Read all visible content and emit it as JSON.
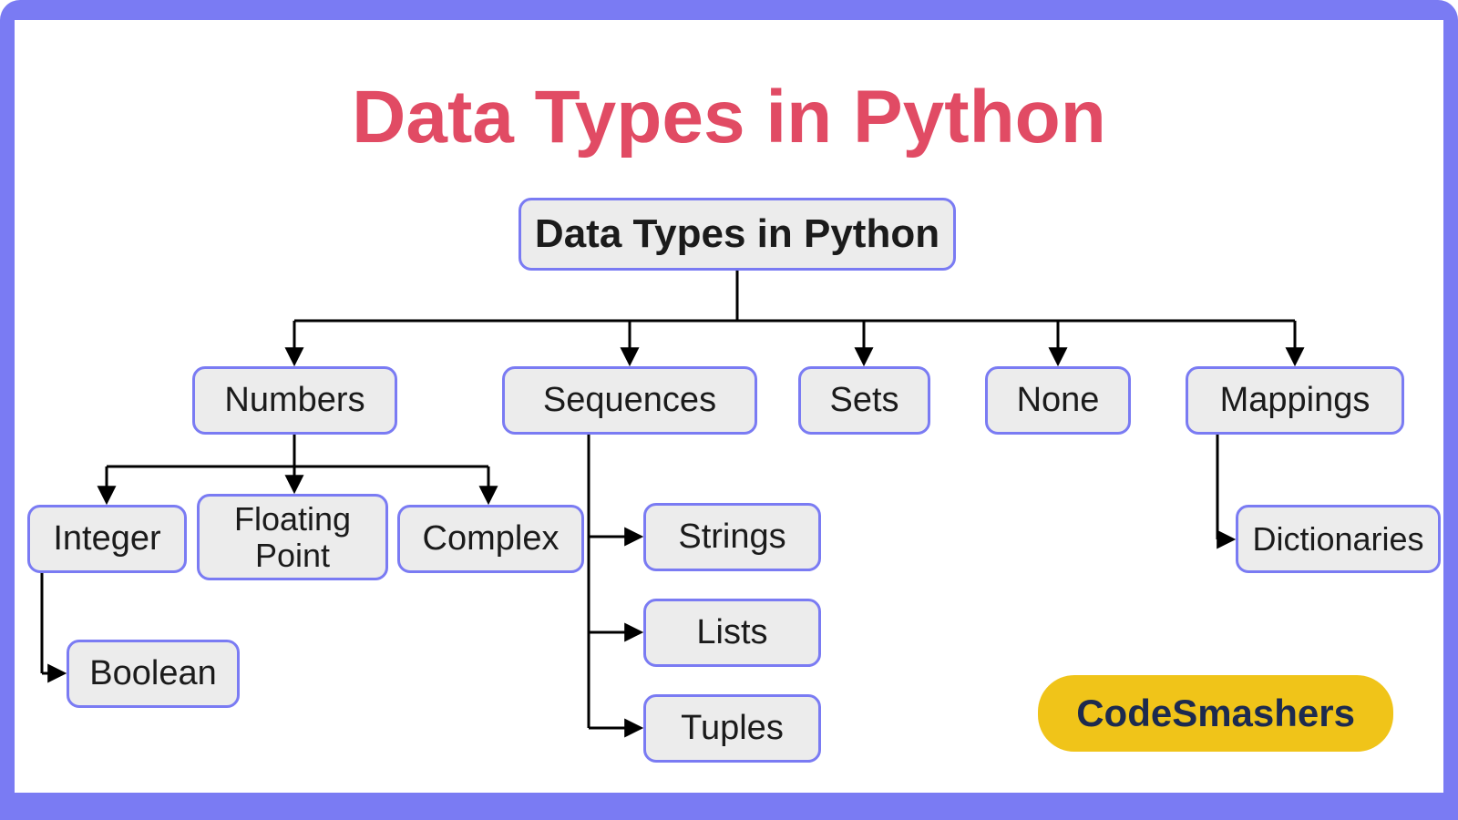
{
  "title": "Data Types in Python",
  "root": "Data Types in Python",
  "level1": {
    "numbers": "Numbers",
    "sequences": "Sequences",
    "sets": "Sets",
    "none": "None",
    "mappings": "Mappings"
  },
  "numbers_children": {
    "integer": "Integer",
    "floating_point": "Floating Point",
    "complex": "Complex"
  },
  "integer_children": {
    "boolean": "Boolean"
  },
  "sequences_children": {
    "strings": "Strings",
    "lists": "Lists",
    "tuples": "Tuples"
  },
  "mappings_children": {
    "dictionaries": "Dictionaries"
  },
  "brand": "CodeSmashers",
  "colors": {
    "frame": "#7a7bf3",
    "title": "#e14b64",
    "node_fill": "#ececec",
    "node_border": "#7a7bf3",
    "logo_bg": "#f0c419",
    "logo_fg": "#1c2a4f"
  }
}
